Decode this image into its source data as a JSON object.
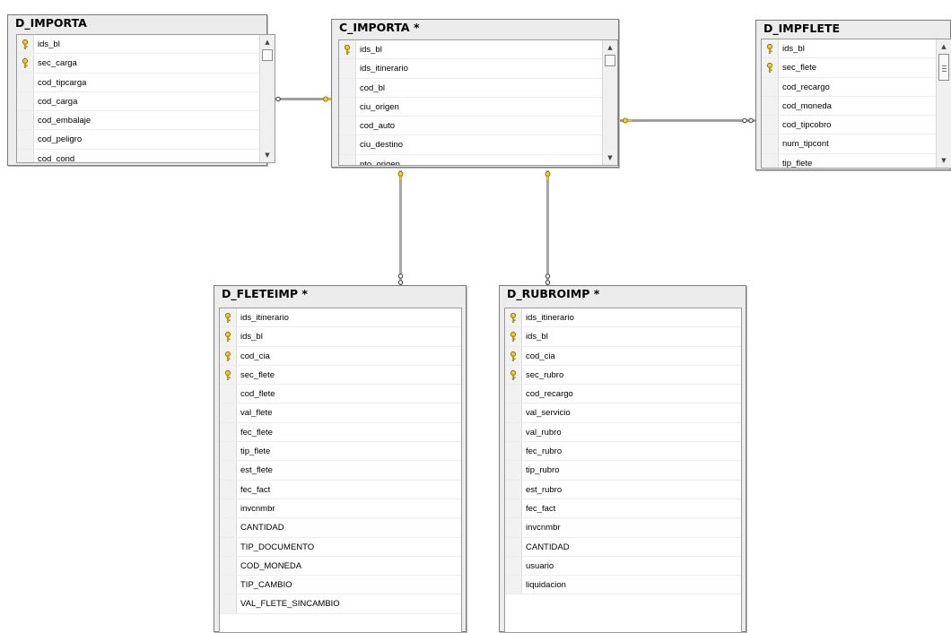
{
  "diagram": {
    "tables": [
      {
        "id": "d_importa",
        "title": "D_IMPORTA",
        "scroll": true,
        "columns": [
          {
            "name": "ids_bl",
            "key": true
          },
          {
            "name": "sec_carga",
            "key": true
          },
          {
            "name": "cod_tipcarga",
            "key": false
          },
          {
            "name": "cod_carga",
            "key": false
          },
          {
            "name": "cod_embalaje",
            "key": false
          },
          {
            "name": "cod_peligro",
            "key": false
          },
          {
            "name": "cod_cond",
            "key": false
          }
        ]
      },
      {
        "id": "c_importa",
        "title": "C_IMPORTA *",
        "scroll": true,
        "columns": [
          {
            "name": "ids_bl",
            "key": true
          },
          {
            "name": "ids_itinerario",
            "key": false
          },
          {
            "name": "cod_bl",
            "key": false
          },
          {
            "name": "ciu_origen",
            "key": false
          },
          {
            "name": "cod_auto",
            "key": false
          },
          {
            "name": "ciu_destino",
            "key": false
          },
          {
            "name": "pto_origen",
            "key": false
          }
        ]
      },
      {
        "id": "d_impflete",
        "title": "D_IMPFLETE",
        "scroll": true,
        "columns": [
          {
            "name": "ids_bl",
            "key": true
          },
          {
            "name": "sec_flete",
            "key": true
          },
          {
            "name": "cod_recargo",
            "key": false
          },
          {
            "name": "cod_moneda",
            "key": false
          },
          {
            "name": "cod_tipcobro",
            "key": false
          },
          {
            "name": "num_tipcont",
            "key": false
          },
          {
            "name": "tip_flete",
            "key": false
          }
        ]
      },
      {
        "id": "d_fleteimp",
        "title": "D_FLETEIMP *",
        "scroll": false,
        "columns": [
          {
            "name": "ids_itinerario",
            "key": true
          },
          {
            "name": "ids_bl",
            "key": true
          },
          {
            "name": "cod_cia",
            "key": true
          },
          {
            "name": "sec_flete",
            "key": true
          },
          {
            "name": "cod_flete",
            "key": false
          },
          {
            "name": "val_flete",
            "key": false
          },
          {
            "name": "fec_flete",
            "key": false
          },
          {
            "name": "tip_flete",
            "key": false
          },
          {
            "name": "est_flete",
            "key": false
          },
          {
            "name": "fec_fact",
            "key": false
          },
          {
            "name": "invcnmbr",
            "key": false
          },
          {
            "name": "CANTIDAD",
            "key": false
          },
          {
            "name": "TIP_DOCUMENTO",
            "key": false
          },
          {
            "name": "COD_MONEDA",
            "key": false
          },
          {
            "name": "TIP_CAMBIO",
            "key": false
          },
          {
            "name": "VAL_FLETE_SINCAMBIO",
            "key": false
          }
        ]
      },
      {
        "id": "d_rubroimp",
        "title": "D_RUBROIMP *",
        "scroll": false,
        "columns": [
          {
            "name": "ids_itinerario",
            "key": true
          },
          {
            "name": "ids_bl",
            "key": true
          },
          {
            "name": "cod_cia",
            "key": true
          },
          {
            "name": "sec_rubro",
            "key": true
          },
          {
            "name": "cod_recargo",
            "key": false
          },
          {
            "name": "val_servicio",
            "key": false
          },
          {
            "name": "val_rubro",
            "key": false
          },
          {
            "name": "fec_rubro",
            "key": false
          },
          {
            "name": "tip_rubro",
            "key": false
          },
          {
            "name": "est_rubro",
            "key": false
          },
          {
            "name": "fec_fact",
            "key": false
          },
          {
            "name": "invcnmbr",
            "key": false
          },
          {
            "name": "CANTIDAD",
            "key": false
          },
          {
            "name": "usuario",
            "key": false
          },
          {
            "name": "liquidacion",
            "key": false
          }
        ]
      }
    ],
    "relationships": [
      {
        "from": "d_importa",
        "to": "c_importa"
      },
      {
        "from": "d_impflete",
        "to": "c_importa"
      },
      {
        "from": "d_fleteimp",
        "to": "c_importa"
      },
      {
        "from": "d_rubroimp",
        "to": "c_importa"
      }
    ]
  }
}
